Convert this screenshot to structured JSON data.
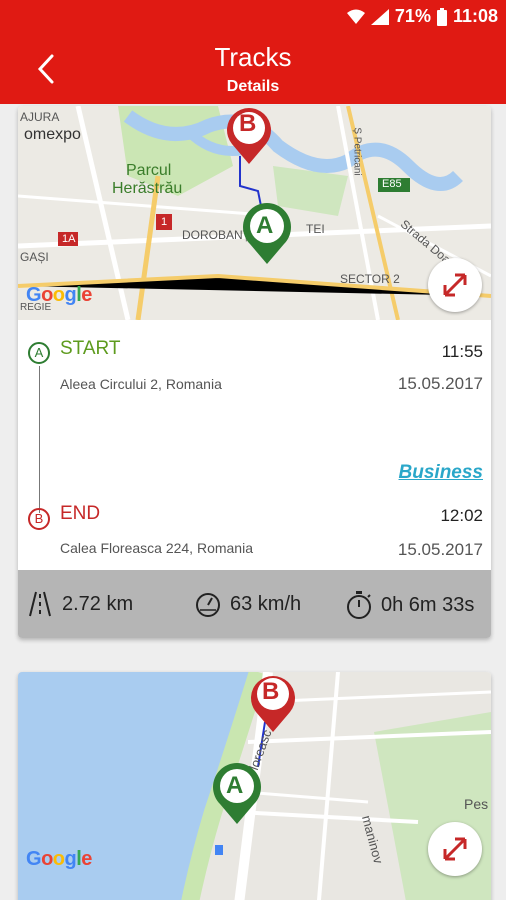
{
  "status_bar": {
    "battery": "71%",
    "time": "11:08"
  },
  "app_bar": {
    "title": "Tracks",
    "subtitle": "Details"
  },
  "tracks": [
    {
      "map": {
        "labels": [
          "AJURA",
          "omexpo",
          "Parcul",
          "Herăstrău",
          "DOROBANȚI",
          "TEI",
          "SECTOR 2",
          "Strada Doam",
          "E85",
          "1A",
          "1",
          "GAȘI",
          "REGIE",
          "Ș Petricani"
        ],
        "pin_start": "A",
        "pin_end": "B"
      },
      "start": {
        "marker": "A",
        "label": "START",
        "address": "Aleea Circului 2, Romania",
        "time": "11:55",
        "date": "15.05.2017"
      },
      "category": "Business",
      "end": {
        "marker": "B",
        "label": "END",
        "address": "Calea Floreasca 224, Romania",
        "time": "12:02",
        "date": "15.05.2017"
      },
      "stats": {
        "distance": "2.72 km",
        "speed": "63 km/h",
        "duration": "0h 6m 33s"
      }
    },
    {
      "map": {
        "labels": [
          "Pes",
          "Floreasc",
          "maninov"
        ],
        "pin_start": "A",
        "pin_end": "B"
      }
    }
  ],
  "google_logo": "Google",
  "colors": {
    "primary": "#e01a13",
    "start": "#2e7d32",
    "end": "#c62828",
    "link": "#2aa7c9"
  }
}
